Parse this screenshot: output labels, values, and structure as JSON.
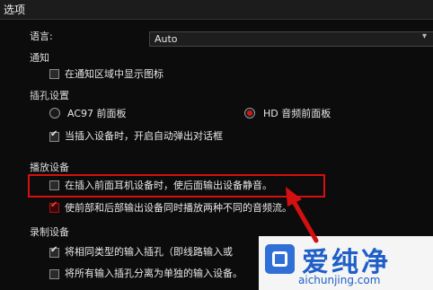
{
  "window": {
    "title": "选项"
  },
  "language": {
    "label": "语言:",
    "value": "Auto"
  },
  "notify": {
    "heading": "通知",
    "show_icon": {
      "label": "在通知区域中显示图标",
      "checked": false
    }
  },
  "jack": {
    "heading": "插孔设置",
    "options": [
      {
        "label": "AC97 前面板",
        "selected": false
      },
      {
        "label": "HD 音频前面板",
        "selected": true
      }
    ],
    "auto_popup": {
      "label": "当插入设备时，开启自动弹出对话框",
      "checked": true
    }
  },
  "playback": {
    "heading": "播放设备",
    "mute_rear": {
      "label": "在插入前面耳机设备时，使后面输出设备静音。",
      "checked": false
    },
    "two_streams": {
      "label": "使前部和后部输出设备同时播放两种不同的音频流。",
      "checked": true
    }
  },
  "recording": {
    "heading": "录制设备",
    "same_type": {
      "label": "将相同类型的输入插孔（即线路输入或",
      "checked": true
    },
    "separate": {
      "label": "将所有输入插孔分离为单独的输入设备。",
      "checked": false
    }
  },
  "watermark": {
    "text": "爱纯净",
    "url": "aichunjing.com"
  },
  "colors": {
    "accent": "#d41010",
    "background": "#0c0c0c"
  }
}
